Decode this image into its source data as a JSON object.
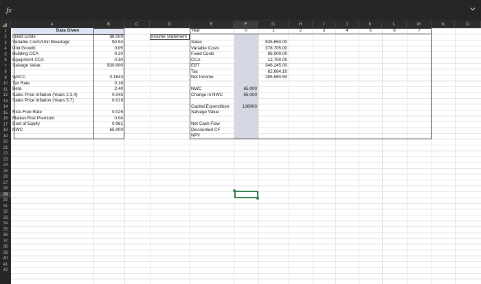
{
  "formula_bar": {
    "fx_label": "fx",
    "value": ""
  },
  "columns": [
    "A",
    "B",
    "C",
    "D",
    "E",
    "F",
    "G",
    "H",
    "I",
    "J",
    "K",
    "L",
    "M",
    "N",
    "O"
  ],
  "rows": [
    "1",
    "2",
    "3",
    "4",
    "5",
    "6",
    "7",
    "8",
    "9",
    "10",
    "11",
    "12",
    "13",
    "14",
    "15",
    "16",
    "17",
    "18",
    "19",
    "20",
    "21",
    "22",
    "23",
    "24",
    "25",
    "26",
    "27",
    "28",
    "29",
    "30",
    "31",
    "32",
    "33",
    "34",
    "35",
    "36",
    "37",
    "38",
    "39",
    "40",
    "41",
    "42"
  ],
  "selected_column": "F",
  "selected_row": "29",
  "data_given": {
    "title": "Data Given",
    "items": [
      {
        "label": "Fixed Costs",
        "value": "$8,000"
      },
      {
        "label": "Variable Costs/Unit Beverage",
        "value": "$0.94"
      },
      {
        "label": "Unit Growth",
        "value": "0.05"
      },
      {
        "label": "Building CCA",
        "value": "0.10"
      },
      {
        "label": "Equipment CCA",
        "value": "0.30"
      },
      {
        "label": "Salvage Value",
        "value": "$30,000"
      },
      {
        "label": "",
        "value": ""
      },
      {
        "label": "WACC",
        "value": "0.1643"
      },
      {
        "label": "Tax Rate",
        "value": "0.18"
      },
      {
        "label": "Beta",
        "value": "2.40"
      },
      {
        "label": "Sales Price Inflation (Years 2,3,4)",
        "value": "0.045"
      },
      {
        "label": "Sales Price Inflation (Years 5,7)",
        "value": "0.019"
      },
      {
        "label": "",
        "value": ""
      },
      {
        "label": "Risk-Free Rate",
        "value": "0.025"
      },
      {
        "label": "Market-Risk Premium",
        "value": "0.04"
      },
      {
        "label": "Cost of Equity",
        "value": "0.061"
      },
      {
        "label": "NWC",
        "value": "65,000"
      }
    ]
  },
  "income_statement": {
    "label": "Income Statement",
    "year_label": "Year",
    "years": [
      "0",
      "1",
      "2",
      "3",
      "4",
      "5",
      "6",
      "7"
    ],
    "rows": [
      {
        "label": "",
        "y0": "",
        "y1": ""
      },
      {
        "label": "Sales",
        "y0": "",
        "y1": "835,650.00"
      },
      {
        "label": "Variable Costs",
        "y0": "",
        "y1": "378,705.00"
      },
      {
        "label": "Fixed Costs",
        "y0": "",
        "y1": "96,000.00"
      },
      {
        "label": "CCA",
        "y0": "",
        "y1": "12,700.00"
      },
      {
        "label": "EBT",
        "y0": "",
        "y1": "348,245.00"
      },
      {
        "label": "Tax",
        "y0": "",
        "y1": "62,664.10"
      },
      {
        "label": "Net Income",
        "y0": "",
        "y1": "285,560.50"
      },
      {
        "label": "",
        "y0": "",
        "y1": ""
      },
      {
        "label": "NWC",
        "y0": "65,000",
        "y1": ""
      },
      {
        "label": "Change in NWC",
        "y0": "65,000",
        "y1": ""
      },
      {
        "label": "",
        "y0": "",
        "y1": ""
      },
      {
        "label": "Capital Expenditure",
        "y0": "138000",
        "y1": ""
      },
      {
        "label": "Salvage Value",
        "y0": "",
        "y1": ""
      },
      {
        "label": "",
        "y0": "",
        "y1": ""
      },
      {
        "label": "Net Cash Flow",
        "y0": "",
        "y1": ""
      },
      {
        "label": "Discounted CF",
        "y0": "",
        "y1": ""
      },
      {
        "label": "NPV",
        "y0": "",
        "y1": ""
      }
    ]
  }
}
